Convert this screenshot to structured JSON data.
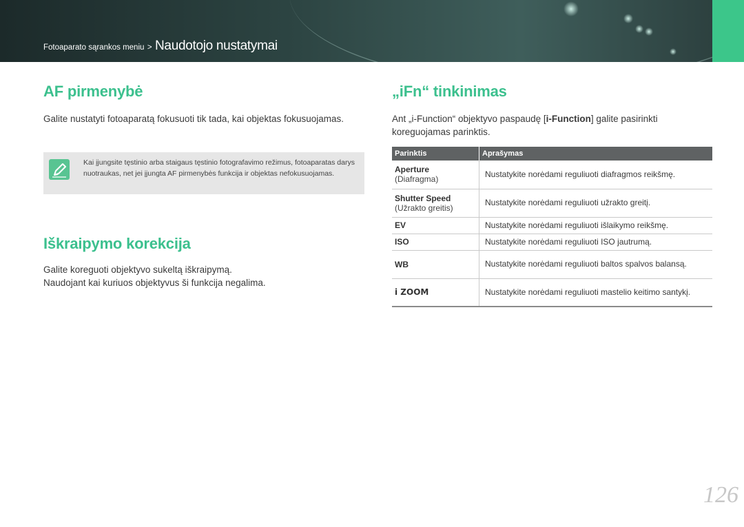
{
  "header": {
    "breadcrumb_parent": "Fotoaparato sąrankos meniu",
    "breadcrumb_sep": ">",
    "breadcrumb_current": "Naudotojo nustatymai"
  },
  "af": {
    "title": "AF pirmenybė",
    "body": "Galite nustatyti fotoaparatą fokusuoti tik tada, kai objektas fokusuojamas.",
    "note": "Kai įjungsite tęstinio arba staigaus tęstinio fotografavimo režimus, fotoaparatas darys nuotraukas, net jei įjungta AF pirmenybės funkcija ir objektas nefokusuojamas."
  },
  "distortion": {
    "title": "Iškraipymo korekcija",
    "line1": "Galite koreguoti objektyvo sukeltą iškraipymą.",
    "line2": "Naudojant kai kuriuos objektyvus ši funkcija negalima."
  },
  "ifn": {
    "title": "„iFn“ tinkinimas",
    "body_before": "Ant „i-Function“ objektyvo paspaudę [",
    "body_button": "i-Function",
    "body_after": "] galite pasirinkti koreguojamas parinktis.",
    "table": {
      "headers": [
        "Parinktis",
        "Aprašymas"
      ],
      "rows": [
        {
          "name": "Aperture",
          "sub": "(Diafragma)",
          "desc": "Nustatykite norėdami reguliuoti diafragmos reikšmę."
        },
        {
          "name": "Shutter Speed",
          "sub": "(Užrakto greitis)",
          "desc": "Nustatykite norėdami reguliuoti užrakto greitį."
        },
        {
          "name": "EV",
          "sub": "",
          "desc": "Nustatykite norėdami reguliuoti išlaikymo reikšmę."
        },
        {
          "name": "ISO",
          "sub": "",
          "desc": "Nustatykite norėdami reguliuoti ISO jautrumą."
        },
        {
          "name": "WB",
          "sub": "",
          "desc": "Nustatykite norėdami reguliuoti baltos spalvos balansą."
        },
        {
          "name": "i ZOOM",
          "sub": "",
          "desc": "Nustatykite norėdami reguliuoti mastelio keitimo santykį."
        }
      ]
    }
  },
  "page_number": "126",
  "colors": {
    "accent": "#3cc08e",
    "header_tab": "#3cc68a",
    "table_header": "#5f6263",
    "note_bg": "#e6e6e6"
  },
  "icons": {
    "note": "pencil-note-icon",
    "zoom": "i-zoom-icon"
  }
}
